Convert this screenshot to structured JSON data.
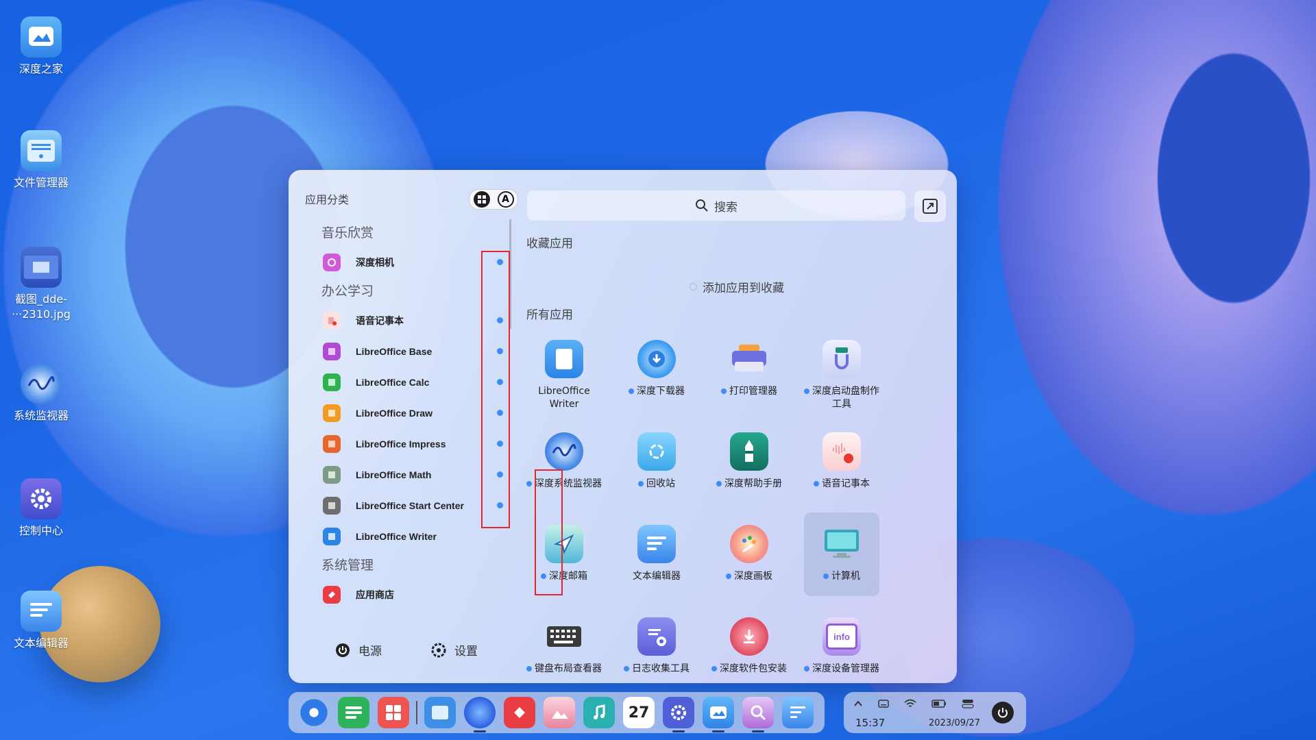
{
  "desktop": {
    "icons": [
      {
        "label": "深度之家",
        "icon": "deepin-home-icon"
      },
      {
        "label": "文件管理器",
        "icon": "file-manager-icon"
      },
      {
        "label": "截图_dde-\n···2310.jpg",
        "icon": "screenshot-image-icon"
      },
      {
        "label": "系统监视器",
        "icon": "system-monitor-icon"
      },
      {
        "label": "控制中心",
        "icon": "control-center-icon"
      },
      {
        "label": "文本编辑器",
        "icon": "text-editor-icon"
      }
    ]
  },
  "launcher": {
    "sidebar_title": "应用分类",
    "view_toggle": {
      "grid_icon": "grid-icon",
      "alpha_label": "A"
    },
    "categories": [
      {
        "header": "音乐欣赏",
        "items": [
          {
            "label": "深度相机",
            "color": "#d05ad8",
            "new": true
          }
        ]
      },
      {
        "header": "办公学习",
        "items": [
          {
            "label": "语音记事本",
            "color": "#f2a2a6",
            "new": true
          },
          {
            "label": "LibreOffice Base",
            "color": "#b14bd3",
            "new": true
          },
          {
            "label": "LibreOffice Calc",
            "color": "#2fb350",
            "new": true
          },
          {
            "label": "LibreOffice Draw",
            "color": "#f39a26",
            "new": true
          },
          {
            "label": "LibreOffice Impress",
            "color": "#e8652d",
            "new": true
          },
          {
            "label": "LibreOffice Math",
            "color": "#7c9a84",
            "new": true
          },
          {
            "label": "LibreOffice Start Center",
            "color": "#6e6e6e",
            "new": true
          },
          {
            "label": "LibreOffice Writer",
            "color": "#2b84e6",
            "new": false
          }
        ]
      },
      {
        "header": "系统管理",
        "items": [
          {
            "label": "应用商店",
            "color": "#ea3d44",
            "new": false
          }
        ]
      }
    ],
    "footer": {
      "power_label": "电源",
      "settings_label": "设置"
    },
    "search": {
      "placeholder": "搜索"
    },
    "favorites": {
      "title": "收藏应用",
      "empty_label": "添加应用到收藏"
    },
    "all_apps": {
      "title": "所有应用",
      "apps": [
        {
          "label": "LibreOffice\nWriter",
          "color": "#2b84e6",
          "new": false,
          "icon": "libreoffice-writer-icon"
        },
        {
          "label": "深度下载器",
          "color": "#3b9cf0",
          "new": true,
          "icon": "downloader-icon"
        },
        {
          "label": "打印管理器",
          "color": "#f3a13a",
          "new": true,
          "icon": "printer-icon"
        },
        {
          "label": "深度启动盘制作\n工具",
          "color": "#7a8fd9",
          "new": true,
          "icon": "boot-maker-icon"
        },
        {
          "label": "深度系统监视器",
          "color": "#2a67e0",
          "new": true,
          "icon": "system-monitor-icon"
        },
        {
          "label": "回收站",
          "color": "#39a8e8",
          "new": true,
          "icon": "trash-icon"
        },
        {
          "label": "深度帮助手册",
          "color": "#1f8f7a",
          "new": true,
          "icon": "manual-icon"
        },
        {
          "label": "语音记事本",
          "color": "#f2a2a6",
          "new": true,
          "icon": "voice-note-icon"
        },
        {
          "label": "深度邮箱",
          "color": "#2f9ad8",
          "new": true,
          "icon": "mail-icon"
        },
        {
          "label": "文本编辑器",
          "color": "#3a85ea",
          "new": false,
          "icon": "text-editor-icon"
        },
        {
          "label": "深度画板",
          "color": "#e86a88",
          "new": true,
          "icon": "draw-board-icon"
        },
        {
          "label": "计算机",
          "color": "#33a6b8",
          "new": true,
          "icon": "computer-icon",
          "selected": true
        },
        {
          "label": "键盘布局查看器",
          "color": "#555555",
          "new": true,
          "icon": "keyboard-icon"
        },
        {
          "label": "日志收集工具",
          "color": "#6c6fe0",
          "new": true,
          "icon": "log-viewer-icon"
        },
        {
          "label": "深度软件包安装",
          "color": "#e04a60",
          "new": true,
          "icon": "package-installer-icon"
        },
        {
          "label": "深度设备管理器",
          "color": "#8f5ed6",
          "new": true,
          "icon": "device-manager-icon",
          "text": "info"
        }
      ]
    }
  },
  "dock": {
    "items": [
      {
        "icon": "launcher-icon",
        "color": "#2e7be8"
      },
      {
        "icon": "multitask-view-icon",
        "color": "#2fb35a"
      },
      {
        "icon": "workspace-icon",
        "color": "#ef5450"
      },
      {
        "icon": "file-manager-icon",
        "color": "#3d8fe8"
      },
      {
        "icon": "browser-icon",
        "color": "#2a5fe0"
      },
      {
        "icon": "app-store-icon",
        "color": "#ea3d44"
      },
      {
        "icon": "image-viewer-icon",
        "color": "#e8849e"
      },
      {
        "icon": "music-icon",
        "color": "#2bb0b0"
      },
      {
        "icon": "calendar-icon",
        "color": "#ffffff",
        "text": "27"
      },
      {
        "icon": "control-center-icon",
        "color": "#4e5fd8"
      },
      {
        "icon": "deepin-home-icon",
        "color": "#3a8fe6"
      },
      {
        "icon": "search-app-icon",
        "color": "#b06ad8"
      },
      {
        "icon": "text-editor-icon",
        "color": "#3a85ea"
      }
    ]
  },
  "tray": {
    "time": "15:37",
    "date": "2023/09/27",
    "icons": [
      "chevron-up-icon",
      "keyboard-icon",
      "wifi-icon",
      "battery-icon",
      "toggle-icon"
    ]
  },
  "colors": {
    "new_dot": "#3d8cf5",
    "annotation_box": "#e6262e"
  }
}
